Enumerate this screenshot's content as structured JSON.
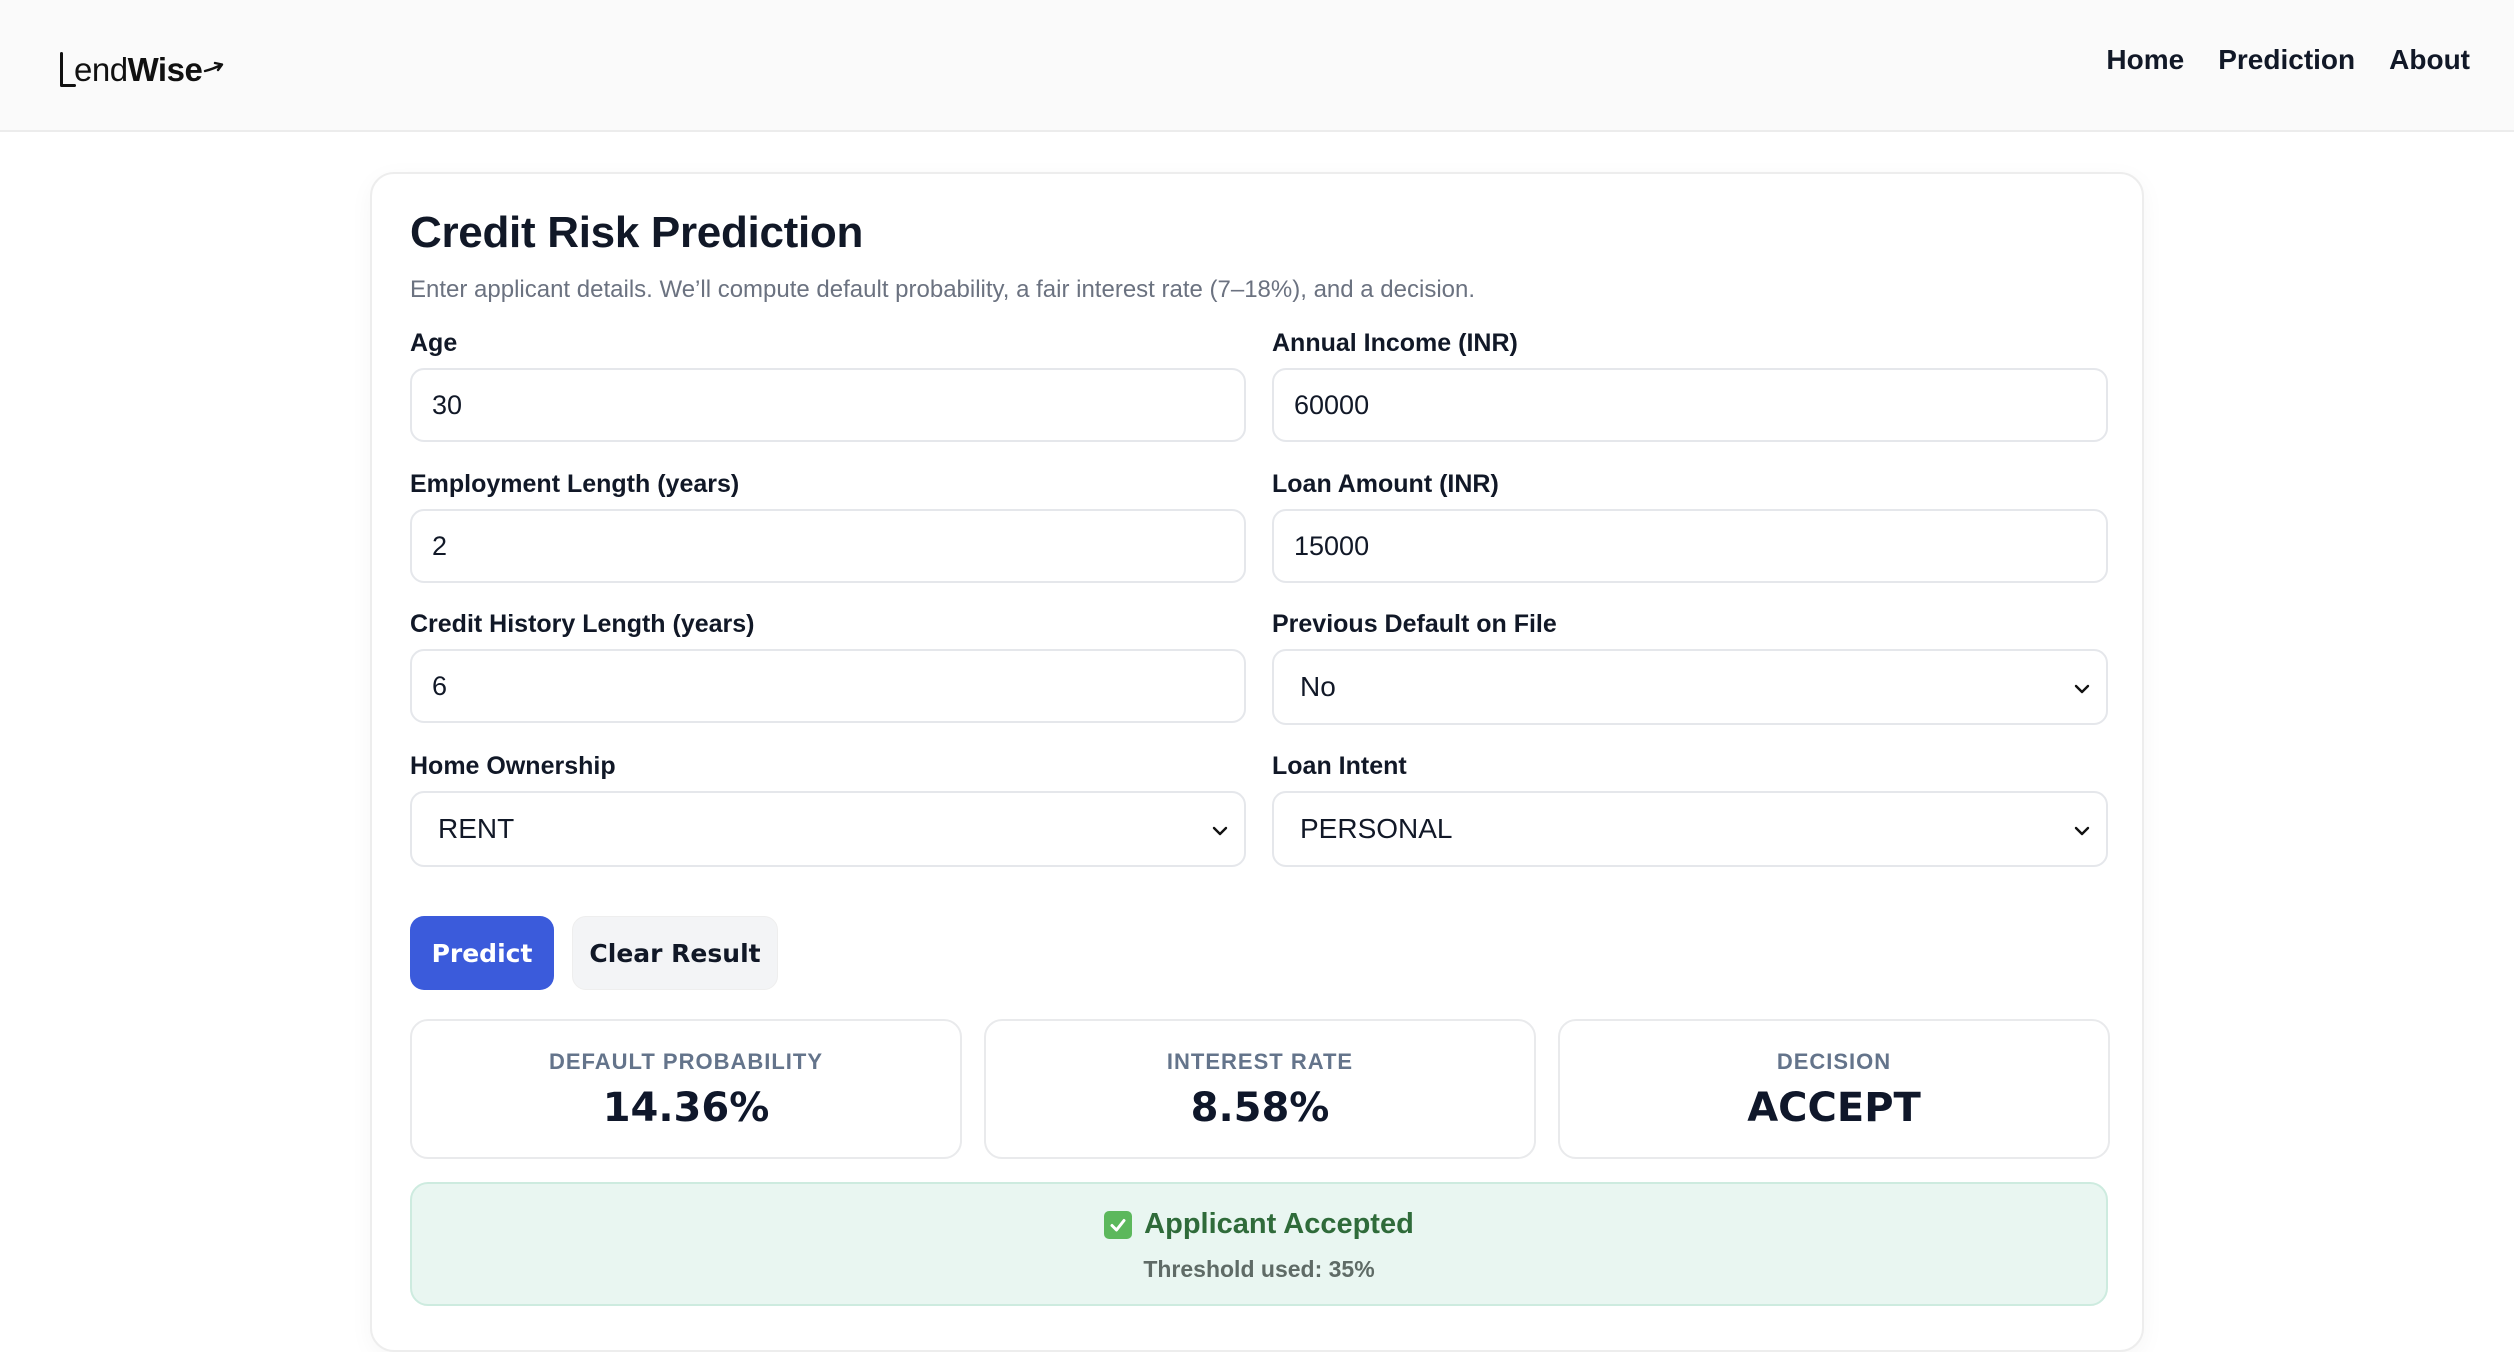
{
  "brand": {
    "prefix": "end",
    "suffix": "Wise"
  },
  "nav": {
    "home": "Home",
    "prediction": "Prediction",
    "about": "About"
  },
  "form": {
    "title": "Credit Risk Prediction",
    "subtitle": "Enter applicant details. We’ll compute default probability, a fair interest rate (7–18%), and a decision.",
    "fields": {
      "age": {
        "label": "Age",
        "value": "30"
      },
      "annual_income": {
        "label": "Annual Income (INR)",
        "value": "60000"
      },
      "employment_length": {
        "label": "Employment Length (years)",
        "value": "2"
      },
      "loan_amount": {
        "label": "Loan Amount (INR)",
        "value": "15000"
      },
      "credit_history": {
        "label": "Credit History Length (years)",
        "value": "6"
      },
      "previous_default": {
        "label": "Previous Default on File",
        "value": "No"
      },
      "home_ownership": {
        "label": "Home Ownership",
        "value": "RENT"
      },
      "loan_intent": {
        "label": "Loan Intent",
        "value": "PERSONAL"
      }
    },
    "buttons": {
      "predict": "Predict",
      "clear": "Clear Result"
    }
  },
  "results": {
    "default_probability": {
      "label": "DEFAULT PROBABILITY",
      "value": "14.36%"
    },
    "interest_rate": {
      "label": "INTEREST RATE",
      "value": "8.58%"
    },
    "decision": {
      "label": "DECISION",
      "value": "ACCEPT"
    },
    "banner": {
      "title": "Applicant Accepted",
      "threshold": "Threshold used: 35%"
    }
  },
  "colors": {
    "primary": "#3b5bdb",
    "success_bg": "#e9f6f1",
    "success_text": "#2f6b3a"
  },
  "icons": {
    "select_arrow": "chevron-down-icon",
    "success": "check-icon",
    "logo": "lendwise-logo-icon"
  }
}
